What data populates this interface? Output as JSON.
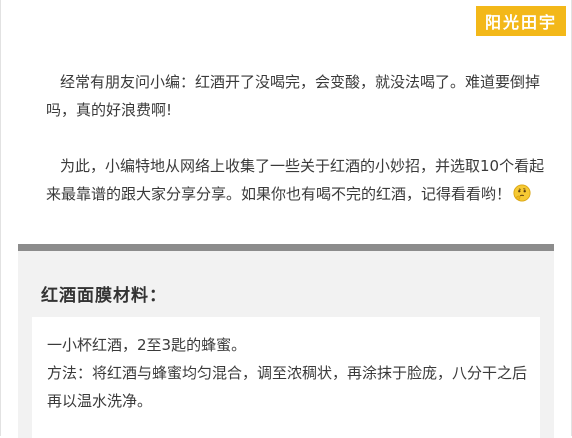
{
  "brand": {
    "label": "阳光田宇"
  },
  "intro": {
    "paragraph_1": "经常有朋友问小编：红酒开了没喝完，会变酸，就没法喝了。难道要倒掉吗，真的好浪费啊!",
    "paragraph_2": "为此，小编特地从网络上收集了一些关于红酒的小妙招，并选取10个看起来最靠谱的跟大家分享分享。如果你也有喝不完的红酒，记得看看哟！",
    "emoji": "thinking-face-icon"
  },
  "section": {
    "title": "红酒面膜材料：",
    "lines": [
      "一小杯红酒，2至3匙的蜂蜜。",
      "方法：将红酒与蜂蜜均匀混合，调至浓稠状，再涂抹于脸庞，八分干之后再以温水洗净。"
    ]
  },
  "colors": {
    "brand_badge": "#f3b819",
    "divider": "#8c8c8c",
    "section_bg": "#f2f2f2",
    "text": "#3a3a3a"
  }
}
